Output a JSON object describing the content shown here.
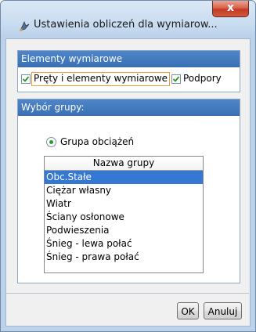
{
  "window": {
    "title": "Ustawienia obliczeń dla wymiarow...",
    "icon": "app-dimension-icon",
    "close_label": "x"
  },
  "group_elements": {
    "header": "Elementy wymiarowe",
    "checkboxes": [
      {
        "label": "Pręty i elementy wymiarowe",
        "checked": true
      },
      {
        "label": "Podpory",
        "checked": true
      }
    ]
  },
  "group_selection": {
    "header": "Wybór grupy:",
    "radio": {
      "label": "Grupa obciążeń",
      "selected": true
    },
    "list": {
      "column_header": "Nazwa grupy",
      "rows": [
        {
          "name": "Obc.Stałe",
          "selected": true
        },
        {
          "name": "Ciężar własny",
          "selected": false
        },
        {
          "name": "Wiatr",
          "selected": false
        },
        {
          "name": "Ściany osłonowe",
          "selected": false
        },
        {
          "name": "Podwieszenia",
          "selected": false
        },
        {
          "name": "Śnieg - lewa połać",
          "selected": false
        },
        {
          "name": "Śnieg - prawa połać",
          "selected": false
        }
      ]
    }
  },
  "buttons": {
    "ok": "OK",
    "cancel": "Anuluj"
  },
  "colors": {
    "group_header": "#3a6fb3",
    "selection": "#3478d4",
    "check": "#2e9a2e",
    "close_button": "#c23a22"
  }
}
